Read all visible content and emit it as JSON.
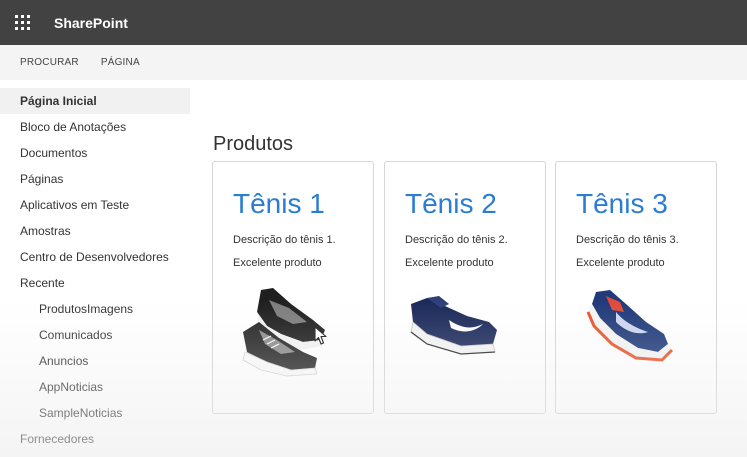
{
  "suite": {
    "brand": "SharePoint"
  },
  "ribbon": {
    "tabs": [
      "PROCURAR",
      "PÁGINA"
    ]
  },
  "nav": {
    "items": [
      {
        "label": "Página Inicial",
        "selected": true,
        "level": 0
      },
      {
        "label": "Bloco de Anotações",
        "level": 0
      },
      {
        "label": "Documentos",
        "level": 0
      },
      {
        "label": "Páginas",
        "level": 0
      },
      {
        "label": "Aplicativos em Teste",
        "level": 0
      },
      {
        "label": "Amostras",
        "level": 0
      },
      {
        "label": "Centro de Desenvolvedores",
        "level": 0
      },
      {
        "label": "Recente",
        "level": 0
      },
      {
        "label": "ProdutosImagens",
        "level": 1
      },
      {
        "label": "Comunicados",
        "level": 1
      },
      {
        "label": "Anuncios",
        "level": 1
      },
      {
        "label": "AppNoticias",
        "level": 1
      },
      {
        "label": "SampleNoticias",
        "level": 1
      },
      {
        "label": "Fornecedores",
        "level": 0
      }
    ]
  },
  "main": {
    "title": "Produtos",
    "products": [
      {
        "name": "Tênis 1",
        "description": "Descrição do tênis 1.",
        "quality": "Excelente produto",
        "image": "sneaker-black-grey"
      },
      {
        "name": "Tênis 2",
        "description": "Descrição do tênis 2.",
        "quality": "Excelente produto",
        "image": "sneaker-navy-white"
      },
      {
        "name": "Tênis 3",
        "description": "Descrição do tênis 3.",
        "quality": "Excelente produto",
        "image": "sneaker-navy-orange"
      }
    ]
  },
  "colors": {
    "suitebar": "#424242",
    "accent": "#2b7cd3",
    "ribbon": "#f4f4f4"
  }
}
